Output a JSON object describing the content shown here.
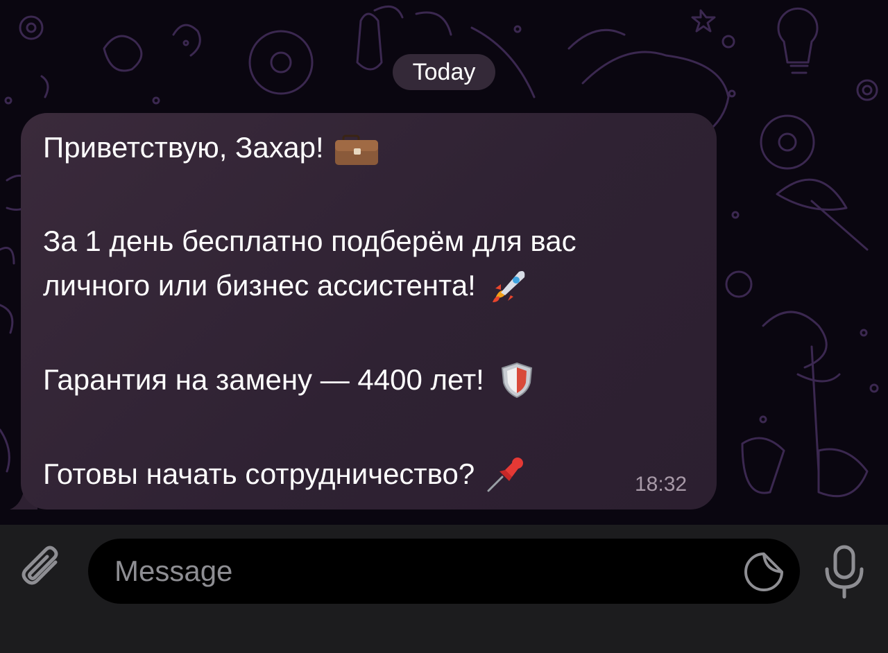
{
  "chat": {
    "date_separator": "Today",
    "message": {
      "lines": [
        "Приветствую, Захар!",
        "За 1 день бесплатно подберём для вас",
        "личного или бизнес ассистента!",
        "Гарантия на замену — 4400 лет!",
        "Готовы начать сотрудничество?"
      ],
      "emojis": [
        "briefcase",
        "rocket",
        "shield",
        "pushpin"
      ],
      "time": "18:32"
    }
  },
  "composer": {
    "placeholder": "Message",
    "icons": [
      "paperclip-icon",
      "sticker-icon",
      "microphone-icon"
    ]
  },
  "colors": {
    "chat_background": "#0a0610",
    "doodle_stroke": "#3b2850",
    "bubble": "#35263a",
    "date_pill": "#3c3040",
    "input_bar": "#1c1c1e",
    "input_field": "#000000",
    "placeholder": "#8e8e93",
    "time_text": "#a89aa8"
  }
}
